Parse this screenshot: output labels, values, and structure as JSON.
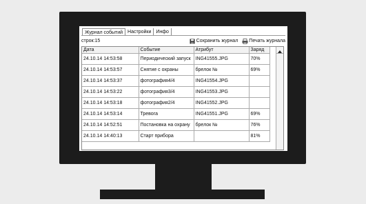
{
  "tabs": [
    {
      "label": "Журнал событий"
    },
    {
      "label": "Настройки"
    },
    {
      "label": "Инфо"
    }
  ],
  "toolbar": {
    "row_count": "строк:15",
    "save_label": "Сохранить журнал",
    "print_label": "Печать журнала"
  },
  "table": {
    "headers": [
      "Дата",
      "Событие",
      "Атрибут",
      "Заряд"
    ],
    "rows": [
      [
        "24.10.14 14:53:58",
        "Периодический запуск",
        "ING41555.JPG",
        "70%"
      ],
      [
        "24.10.14 14:53:57",
        "Снятие с охраны",
        "брелок №",
        "69%"
      ],
      [
        "24.10.14 14:53:37",
        "фотография4/4",
        "ING41554.JPG",
        ""
      ],
      [
        "24.10.14 14:53:22",
        "фотография3/4",
        "ING41553.JPG",
        ""
      ],
      [
        "24.10.14 14:53:18",
        "фотография2/4",
        "ING41552.JPG",
        ""
      ],
      [
        "24.10.14 14:53:14",
        "Тревога",
        "ING41551.JPG",
        "69%"
      ],
      [
        "24.10.14 14:52:51",
        "Постановка на охрану",
        "брелок №",
        "76%"
      ],
      [
        "24.10.14 14:40:13",
        "Старт прибора",
        "",
        "81%"
      ]
    ]
  }
}
